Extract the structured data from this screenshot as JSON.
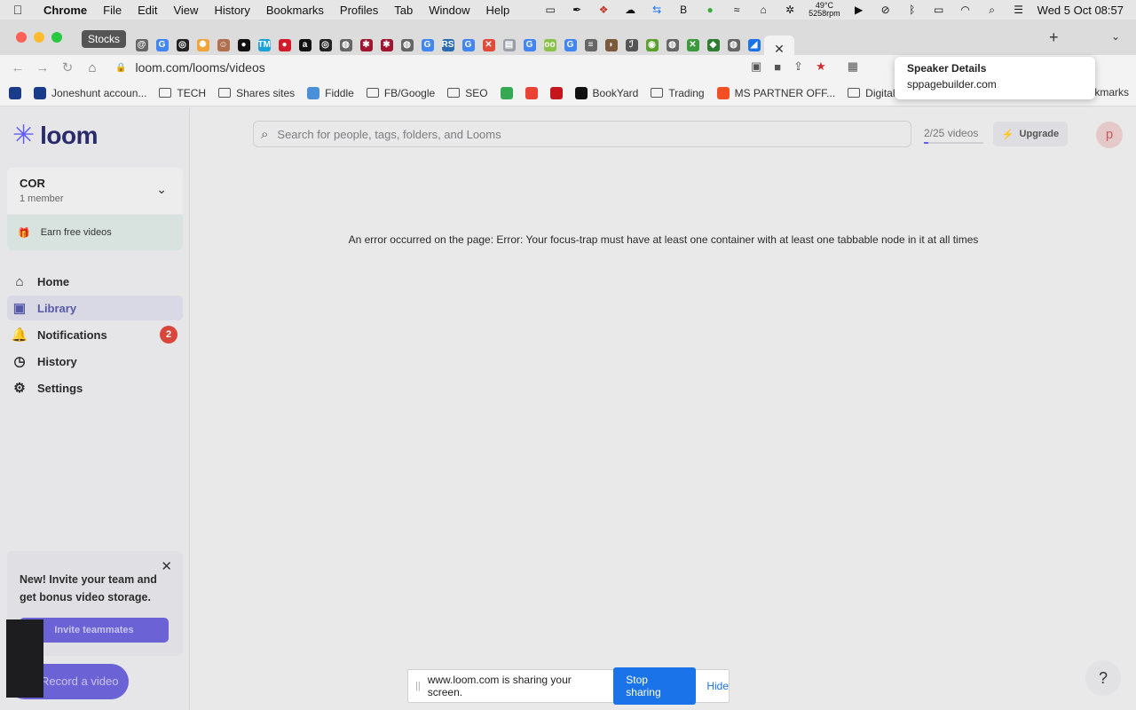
{
  "menubar": {
    "app": "Chrome",
    "items": [
      "File",
      "Edit",
      "View",
      "History",
      "Bookmarks",
      "Profiles",
      "Tab",
      "Window",
      "Help"
    ],
    "temp_line1": "49°C",
    "temp_line2": "5258rpm",
    "clock": "Wed 5 Oct  08:57"
  },
  "tabs": {
    "hover_tooltip": "Stocks",
    "favicons": [
      {
        "color": "#666666",
        "glyph": "@"
      },
      {
        "color": "#4285f4",
        "glyph": "G"
      },
      {
        "color": "#222222",
        "glyph": "◎"
      },
      {
        "color": "#f2a33a",
        "glyph": "✺"
      },
      {
        "color": "#b07050",
        "glyph": "☺"
      },
      {
        "color": "#111111",
        "glyph": "●"
      },
      {
        "color": "#1ba3d8",
        "glyph": "TM"
      },
      {
        "color": "#d11a2a",
        "glyph": "●"
      },
      {
        "color": "#111111",
        "glyph": "a"
      },
      {
        "color": "#222222",
        "glyph": "◎"
      },
      {
        "color": "#666666",
        "glyph": "◍"
      },
      {
        "color": "#a01530",
        "glyph": "✱"
      },
      {
        "color": "#a01530",
        "glyph": "✱"
      },
      {
        "color": "#666666",
        "glyph": "◍"
      },
      {
        "color": "#4285f4",
        "glyph": "G"
      },
      {
        "color": "#2b6cb0",
        "glyph": "RS"
      },
      {
        "color": "#4285f4",
        "glyph": "G"
      },
      {
        "color": "#e24a3a",
        "glyph": "✕"
      },
      {
        "color": "#9aa0a6",
        "glyph": "▤"
      },
      {
        "color": "#4285f4",
        "glyph": "G"
      },
      {
        "color": "#8bc34a",
        "glyph": "oo"
      },
      {
        "color": "#4285f4",
        "glyph": "G"
      },
      {
        "color": "#666666",
        "glyph": "≡"
      },
      {
        "color": "#7a5a3a",
        "glyph": "◗"
      },
      {
        "color": "#555555",
        "glyph": "ℐ"
      },
      {
        "color": "#5aa02c",
        "glyph": "◉"
      },
      {
        "color": "#666666",
        "glyph": "◍"
      },
      {
        "color": "#3c9a3c",
        "glyph": "✕"
      },
      {
        "color": "#2e7d32",
        "glyph": "◆"
      },
      {
        "color": "#666666",
        "glyph": "◍"
      },
      {
        "color": "#1a73e8",
        "glyph": "◢"
      }
    ],
    "active_close": "✕",
    "new_tab": "+",
    "menu": "⌄"
  },
  "toolbar": {
    "url": "loom.com/looms/videos"
  },
  "bookmarks": [
    {
      "type": "icon",
      "label": "",
      "color": "#1a3a8a"
    },
    {
      "type": "icon",
      "label": "Joneshunt accoun...",
      "color": "#1a3a8a"
    },
    {
      "type": "folder",
      "label": "TECH"
    },
    {
      "type": "folder",
      "label": "Shares sites"
    },
    {
      "type": "icon",
      "label": "Fiddle",
      "color": "#4a90d9"
    },
    {
      "type": "folder",
      "label": "FB/Google"
    },
    {
      "type": "folder",
      "label": "SEO"
    },
    {
      "type": "icon",
      "label": "",
      "color": "#34a853"
    },
    {
      "type": "icon",
      "label": "",
      "color": "#ea4335"
    },
    {
      "type": "icon",
      "label": "",
      "color": "#c4161c"
    },
    {
      "type": "icon",
      "label": "BookYard",
      "color": "#111111"
    },
    {
      "type": "folder",
      "label": "Trading"
    },
    {
      "type": "icon",
      "label": "MS PARTNER OFF...",
      "color": "#f25022"
    },
    {
      "type": "folder",
      "label": "Digital Nor"
    }
  ],
  "bookmarks_overflow": "kmarks",
  "speaker_tooltip": {
    "title": "Speaker Details",
    "subtitle": "sppagebuilder.com"
  },
  "sidebar": {
    "brand": "loom",
    "workspace": {
      "name": "COR",
      "members": "1 member"
    },
    "earn": "Earn free videos",
    "nav": [
      {
        "label": "Home",
        "icon": "⌂",
        "active": false
      },
      {
        "label": "Library",
        "icon": "▣",
        "active": true
      },
      {
        "label": "Notifications",
        "icon": "🔔",
        "active": false,
        "badge": "2"
      },
      {
        "label": "History",
        "icon": "◷",
        "active": false
      },
      {
        "label": "Settings",
        "icon": "⚙",
        "active": false
      }
    ],
    "invite": {
      "text": "New! Invite your team and get bonus video storage.",
      "button": "Invite teammates"
    },
    "record": "Record a video"
  },
  "main": {
    "search_placeholder": "Search for people, tags, folders, and Looms",
    "video_count": "2/25 videos",
    "video_quota_fraction": 0.08,
    "upgrade": "Upgrade",
    "avatar_initial": "p",
    "error": "An error occurred on the page: Error: Your focus-trap must have at least one container with at least one tabbable node in it at all times",
    "help": "?"
  },
  "share_bar": {
    "text": "www.loom.com is sharing your screen.",
    "stop": "Stop sharing",
    "hide": "Hide"
  },
  "colors": {
    "accent": "#625df5",
    "stop_button": "#1a73e8",
    "badge": "#d9473c"
  }
}
